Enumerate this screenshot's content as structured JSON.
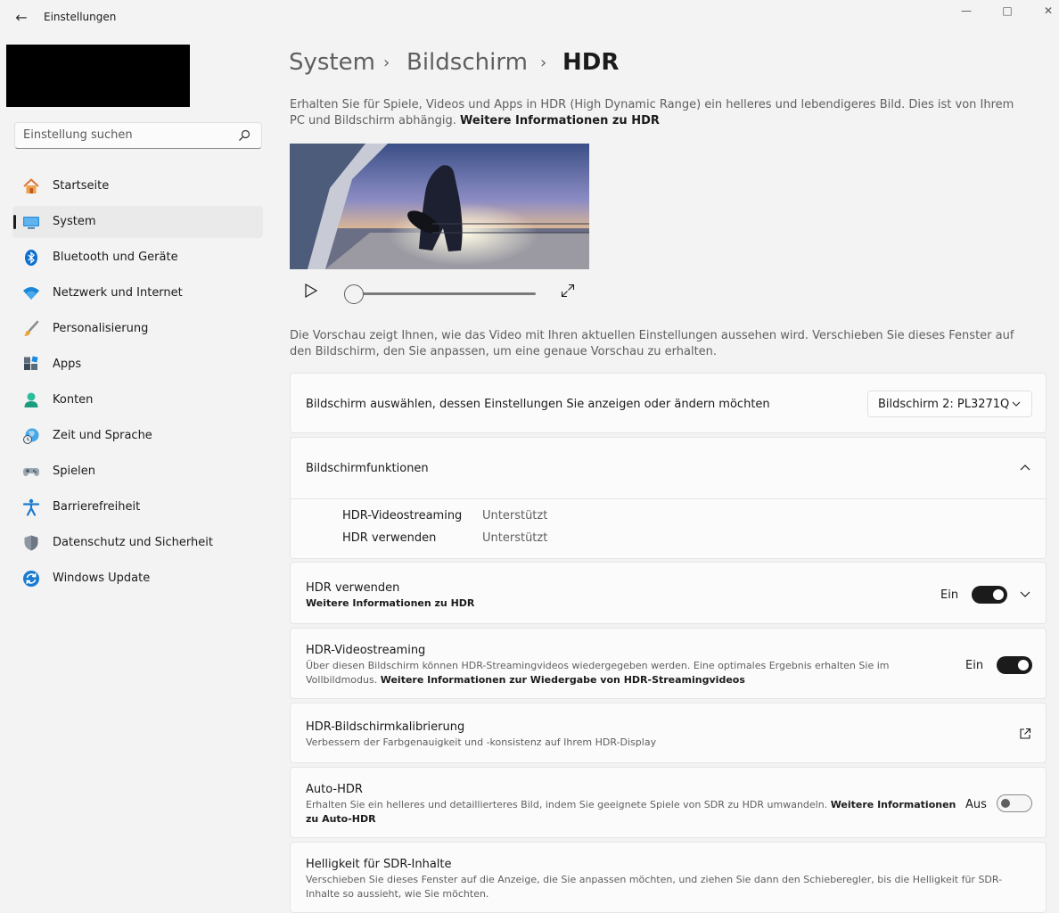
{
  "window": {
    "title": "Einstellungen"
  },
  "search": {
    "placeholder": "Einstellung suchen"
  },
  "sidebar": {
    "items": [
      {
        "label": "Startseite",
        "icon": "home-icon"
      },
      {
        "label": "System",
        "icon": "system-display-icon",
        "active": true
      },
      {
        "label": "Bluetooth und Geräte",
        "icon": "bluetooth-icon"
      },
      {
        "label": "Netzwerk und Internet",
        "icon": "wifi-icon"
      },
      {
        "label": "Personalisierung",
        "icon": "paintbrush-icon"
      },
      {
        "label": "Apps",
        "icon": "apps-icon"
      },
      {
        "label": "Konten",
        "icon": "person-icon"
      },
      {
        "label": "Zeit und Sprache",
        "icon": "globe-clock-icon"
      },
      {
        "label": "Spielen",
        "icon": "gamepad-icon"
      },
      {
        "label": "Barrierefreiheit",
        "icon": "accessibility-icon"
      },
      {
        "label": "Datenschutz und Sicherheit",
        "icon": "shield-icon"
      },
      {
        "label": "Windows Update",
        "icon": "update-icon"
      }
    ]
  },
  "breadcrumb": {
    "items": [
      "System",
      "Bildschirm"
    ],
    "current": "HDR"
  },
  "intro": {
    "text": "Erhalten Sie für Spiele, Videos und Apps in HDR (High Dynamic Range) ein helleres und lebendigeres Bild. Dies ist von Ihrem PC und Bildschirm abhängig.",
    "link": "Weitere Informationen zu HDR"
  },
  "preview_note": "Die Vorschau zeigt Ihnen, wie das Video mit Ihren aktuellen Einstellungen aussehen wird. Verschieben Sie dieses Fenster auf den Bildschirm, den Sie anpassen, um eine genaue Vorschau zu erhalten.",
  "player": {
    "progress": 0
  },
  "display_select": {
    "label": "Bildschirm auswählen, dessen Einstellungen Sie anzeigen oder ändern möchten",
    "value": "Bildschirm 2: PL3271Q"
  },
  "capabilities": {
    "title": "Bildschirmfunktionen",
    "rows": [
      {
        "label": "HDR-Videostreaming",
        "value": "Unterstützt"
      },
      {
        "label": "HDR verwenden",
        "value": "Unterstützt"
      }
    ]
  },
  "use_hdr": {
    "title": "HDR verwenden",
    "link": "Weitere Informationen zu HDR",
    "state": "Ein",
    "on": true
  },
  "streaming": {
    "title": "HDR-Videostreaming",
    "desc": "Über diesen Bildschirm können HDR-Streamingvideos wiedergegeben werden. Eine optimales Ergebnis erhalten Sie im Vollbildmodus.",
    "link": "Weitere Informationen zur Wiedergabe von HDR-Streamingvideos",
    "state": "Ein",
    "on": true
  },
  "calibration": {
    "title": "HDR-Bildschirmkalibrierung",
    "desc": "Verbessern der Farbgenauigkeit und -konsistenz auf Ihrem HDR-Display"
  },
  "auto_hdr": {
    "title": "Auto-HDR",
    "desc": "Erhalten Sie ein helleres und detaillierteres Bild, indem Sie geeignete Spiele von SDR zu HDR umwandeln.",
    "link": "Weitere Informationen zu Auto-HDR",
    "state": "Aus",
    "on": false
  },
  "sdr_brightness": {
    "title": "Helligkeit für SDR-Inhalte",
    "desc": "Verschieben Sie dieses Fenster auf die Anzeige, die Sie anpassen möchten, und ziehen Sie dann den Schieberegler, bis die Helligkeit für SDR-Inhalte so aussieht, wie Sie möchten."
  },
  "colors": {
    "accent": "#1b1b1b",
    "windows_blue": "#0067c0"
  }
}
